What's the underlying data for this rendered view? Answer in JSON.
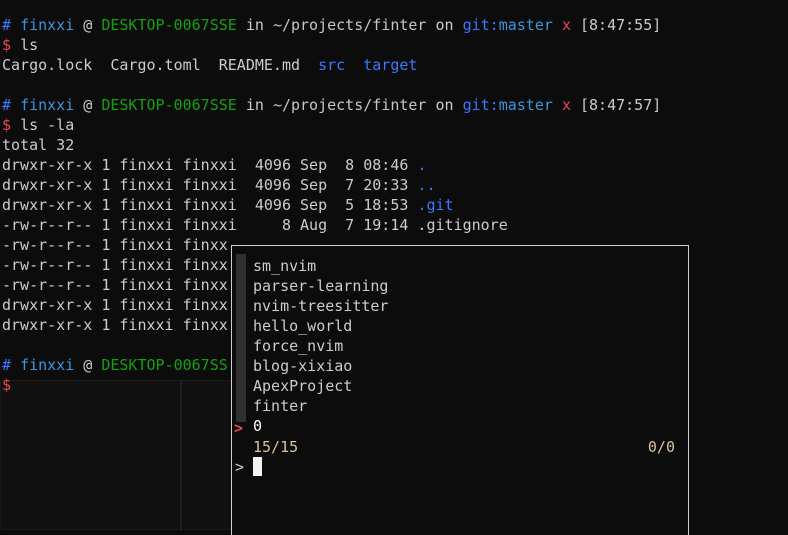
{
  "prompt1": {
    "hash": "#",
    "user": "finxxi",
    "at": "@",
    "host": "DESKTOP-0067SSE",
    "in": "in",
    "path": "~/projects/finter",
    "on": "on",
    "git_label": "git:",
    "branch": "master",
    "dirty": "x",
    "time": "[8:47:55]",
    "dollar": "$",
    "cmd": "ls"
  },
  "ls_output": {
    "files": [
      "Cargo.lock",
      "Cargo.toml",
      "README.md"
    ],
    "dirs": [
      "src",
      "target"
    ]
  },
  "prompt2": {
    "hash": "#",
    "user": "finxxi",
    "at": "@",
    "host": "DESKTOP-0067SSE",
    "in": "in",
    "path": "~/projects/finter",
    "on": "on",
    "git_label": "git:",
    "branch": "master",
    "dirty": "x",
    "time": "[8:47:57]",
    "dollar": "$",
    "cmd": "ls -la"
  },
  "ls_la": {
    "total": "total 32",
    "rows": [
      {
        "meta": "drwxr-xr-x 1 finxxi finxxi  4096 Sep  8 08:46 ",
        "name": "."
      },
      {
        "meta": "drwxr-xr-x 1 finxxi finxxi  4096 Sep  7 20:33 ",
        "name": ".."
      },
      {
        "meta": "drwxr-xr-x 1 finxxi finxxi  4096 Sep  5 18:53 ",
        "name": ".git"
      },
      {
        "meta": "-rw-r--r-- 1 finxxi finxxi     8 Aug  7 19:14 ",
        "name": ".gitignore"
      },
      {
        "meta": "-rw-r--r-- 1 finxxi finxx",
        "name": ""
      },
      {
        "meta": "-rw-r--r-- 1 finxxi finxx",
        "name": ""
      },
      {
        "meta": "-rw-r--r-- 1 finxxi finxx",
        "name": ""
      },
      {
        "meta": "drwxr-xr-x 1 finxxi finxx",
        "name": ""
      },
      {
        "meta": "drwxr-xr-x 1 finxxi finxx",
        "name": ""
      }
    ]
  },
  "prompt3": {
    "hash": "#",
    "user": "finxxi",
    "at": "@",
    "host": "DESKTOP-0067SS",
    "dollar": "$"
  },
  "fzf": {
    "items": [
      "sm_nvim",
      "parser-learning",
      "nvim-treesitter",
      "hello_world",
      "force_nvim",
      "blog-xixiao",
      "ApexProject",
      "finter",
      "0"
    ],
    "selected_marker": ">",
    "match_count": "15/15",
    "selected_count": "0/0",
    "query_prompt": ">",
    "query": ""
  },
  "colors": {
    "background": "#0c0c0c",
    "foreground": "#cccccc",
    "blue": "#3b78ff",
    "green": "#13a10e",
    "red": "#e74856",
    "cyan": "#3a96dd"
  }
}
